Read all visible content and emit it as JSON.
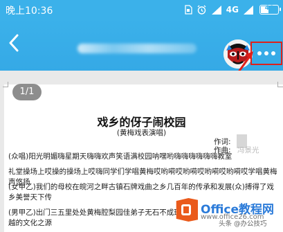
{
  "status": {
    "time": "晚上10:36",
    "network": "4G",
    "battery": "46",
    "battery_level": 0.46
  },
  "toolbar": {
    "back_icon": "chevron-left-icon",
    "more_icon": "more-dots-icon"
  },
  "document": {
    "page_indicator": "1/1",
    "title": "戏乡的伢子闹校园",
    "subtitle": "(黄梅戏表演唱)",
    "lyricist_label": "作词:",
    "composer_label": "作曲:",
    "composer_name": "冯景光",
    "paragraphs": [
      "(众唱)阳光明媚嗨星期天嗨嗨欢声笑语满校园呐嘿哟嗨嗨嗨嗨嗨嗨教室",
      "礼堂操场上哎操的操场上哎嗨同学们学唱黄梅哎哟嗬哎哟嗬哎哟嗬哎哟嗬哎学唱黄梅声悠扬",
      "(女甲乙)我们的母校在皖河之畔古镇石牌戏曲之乡几百年的传承和发展(众)搏得了戏乡美誉天下传",
      "(男甲乙)出门三五里处处黄梅腔梨园佳弟子无石不成班这里"
    ],
    "para4_tail": "越的文化之源"
  },
  "watermark": {
    "brand": "Office教程网",
    "url": "www.office26.com",
    "site": "头条 @办公技巧"
  }
}
